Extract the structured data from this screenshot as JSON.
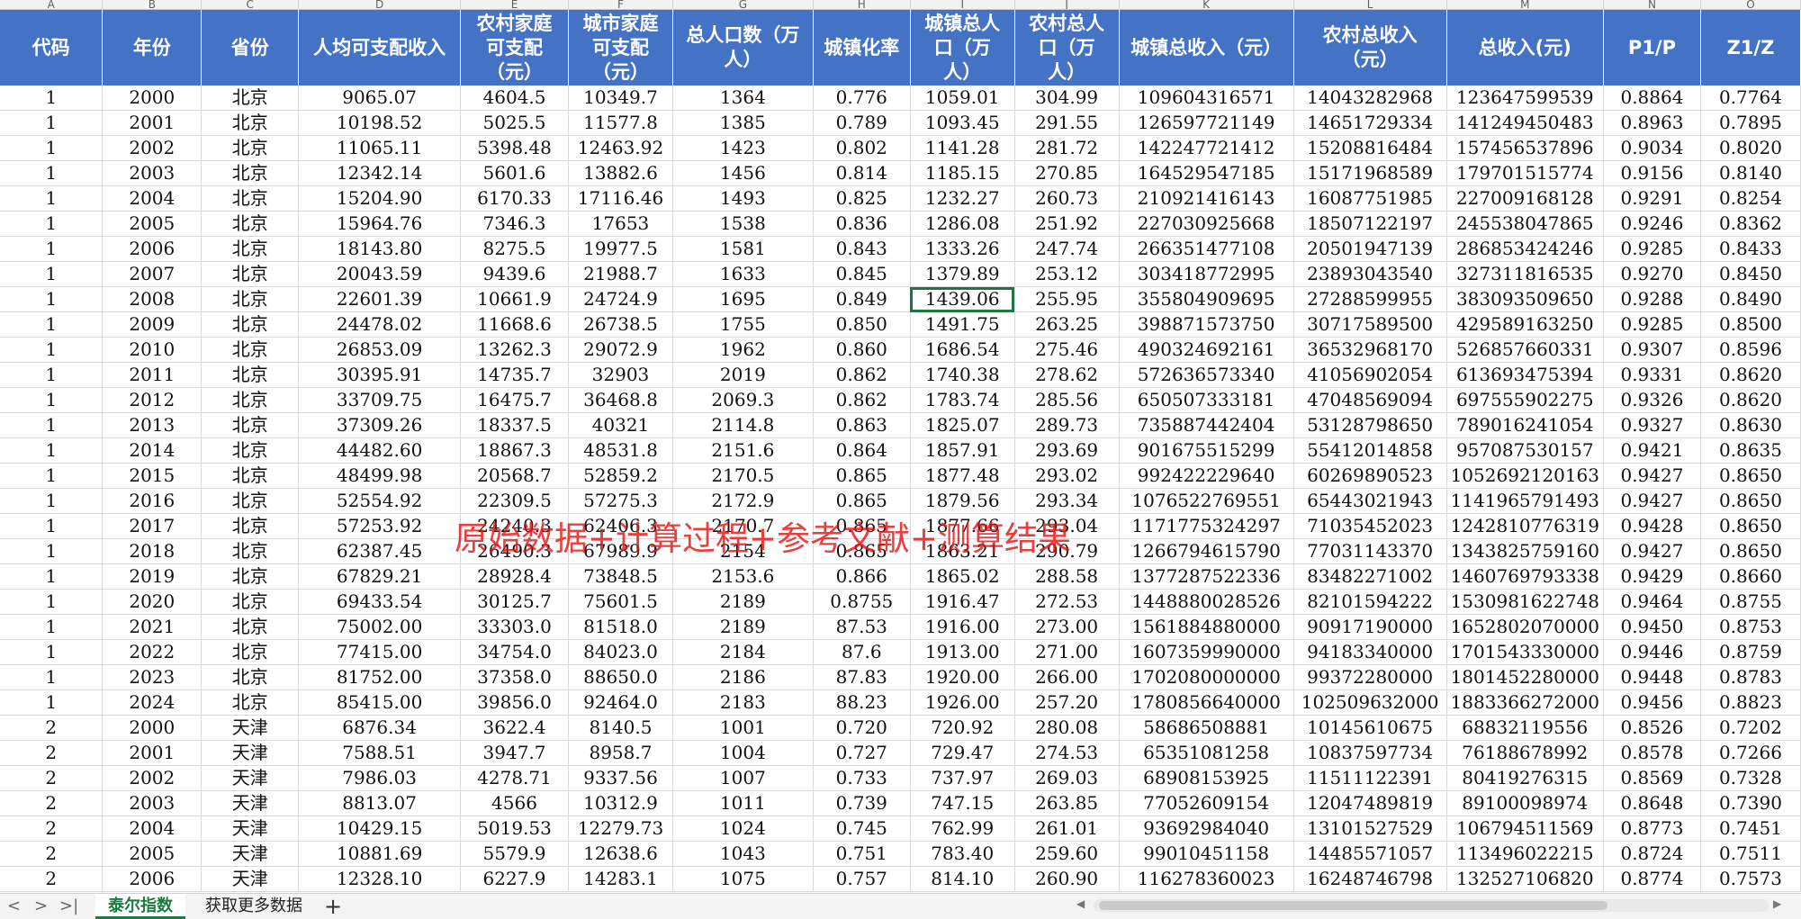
{
  "column_letters": [
    "A",
    "B",
    "C",
    "D",
    "E",
    "F",
    "G",
    "H",
    "I",
    "J",
    "K",
    "L",
    "M",
    "N",
    "O"
  ],
  "headers": [
    [
      "代码"
    ],
    [
      "年份"
    ],
    [
      "省份"
    ],
    [
      "人均可支配收入"
    ],
    [
      "农村家庭",
      "可支配",
      "（元）"
    ],
    [
      "城市家庭",
      "可支配",
      "（元）"
    ],
    [
      "总人口数（万",
      "人）"
    ],
    [
      "城镇化率"
    ],
    [
      "城镇总人",
      "口（万",
      "人）"
    ],
    [
      "农村总人",
      "口（万",
      "人）"
    ],
    [
      "城镇总收入（元）"
    ],
    [
      "农村总收入",
      "（元）"
    ],
    [
      "总收入(元)"
    ],
    [
      "P1/P"
    ],
    [
      "Z1/Z"
    ]
  ],
  "rows": [
    [
      "1",
      "2000",
      "北京",
      "9065.07",
      "4604.5",
      "10349.7",
      "1364",
      "0.776",
      "1059.01",
      "304.99",
      "109604316571",
      "14043282968",
      "123647599539",
      "0.8864",
      "0.7764"
    ],
    [
      "1",
      "2001",
      "北京",
      "10198.52",
      "5025.5",
      "11577.8",
      "1385",
      "0.789",
      "1093.45",
      "291.55",
      "126597721149",
      "14651729334",
      "141249450483",
      "0.8963",
      "0.7895"
    ],
    [
      "1",
      "2002",
      "北京",
      "11065.11",
      "5398.48",
      "12463.92",
      "1423",
      "0.802",
      "1141.28",
      "281.72",
      "142247721412",
      "15208816484",
      "157456537896",
      "0.9034",
      "0.8020"
    ],
    [
      "1",
      "2003",
      "北京",
      "12342.14",
      "5601.6",
      "13882.6",
      "1456",
      "0.814",
      "1185.15",
      "270.85",
      "164529547185",
      "15171968589",
      "179701515774",
      "0.9156",
      "0.8140"
    ],
    [
      "1",
      "2004",
      "北京",
      "15204.90",
      "6170.33",
      "17116.46",
      "1493",
      "0.825",
      "1232.27",
      "260.73",
      "210921416143",
      "16087751985",
      "227009168128",
      "0.9291",
      "0.8254"
    ],
    [
      "1",
      "2005",
      "北京",
      "15964.76",
      "7346.3",
      "17653",
      "1538",
      "0.836",
      "1286.08",
      "251.92",
      "227030925668",
      "18507122197",
      "245538047865",
      "0.9246",
      "0.8362"
    ],
    [
      "1",
      "2006",
      "北京",
      "18143.80",
      "8275.5",
      "19977.5",
      "1581",
      "0.843",
      "1333.26",
      "247.74",
      "266351477108",
      "20501947139",
      "286853424246",
      "0.9285",
      "0.8433"
    ],
    [
      "1",
      "2007",
      "北京",
      "20043.59",
      "9439.6",
      "21988.7",
      "1633",
      "0.845",
      "1379.89",
      "253.12",
      "303418772995",
      "23893043540",
      "327311816535",
      "0.9270",
      "0.8450"
    ],
    [
      "1",
      "2008",
      "北京",
      "22601.39",
      "10661.9",
      "24724.9",
      "1695",
      "0.849",
      "1439.06",
      "255.95",
      "355804909695",
      "27288599955",
      "383093509650",
      "0.9288",
      "0.8490"
    ],
    [
      "1",
      "2009",
      "北京",
      "24478.02",
      "11668.6",
      "26738.5",
      "1755",
      "0.850",
      "1491.75",
      "263.25",
      "398871573750",
      "30717589500",
      "429589163250",
      "0.9285",
      "0.8500"
    ],
    [
      "1",
      "2010",
      "北京",
      "26853.09",
      "13262.3",
      "29072.9",
      "1962",
      "0.860",
      "1686.54",
      "275.46",
      "490324692161",
      "36532968170",
      "526857660331",
      "0.9307",
      "0.8596"
    ],
    [
      "1",
      "2011",
      "北京",
      "30395.91",
      "14735.7",
      "32903",
      "2019",
      "0.862",
      "1740.38",
      "278.62",
      "572636573340",
      "41056902054",
      "613693475394",
      "0.9331",
      "0.8620"
    ],
    [
      "1",
      "2012",
      "北京",
      "33709.75",
      "16475.7",
      "36468.8",
      "2069.3",
      "0.862",
      "1783.74",
      "285.56",
      "650507333181",
      "47048569094",
      "697555902275",
      "0.9326",
      "0.8620"
    ],
    [
      "1",
      "2013",
      "北京",
      "37309.26",
      "18337.5",
      "40321",
      "2114.8",
      "0.863",
      "1825.07",
      "289.73",
      "735887442404",
      "53128798650",
      "789016241054",
      "0.9327",
      "0.8630"
    ],
    [
      "1",
      "2014",
      "北京",
      "44482.60",
      "18867.3",
      "48531.8",
      "2151.6",
      "0.864",
      "1857.91",
      "293.69",
      "901675515299",
      "55412014858",
      "957087530157",
      "0.9421",
      "0.8635"
    ],
    [
      "1",
      "2015",
      "北京",
      "48499.98",
      "20568.7",
      "52859.2",
      "2170.5",
      "0.865",
      "1877.48",
      "293.02",
      "992422229640",
      "60269890523",
      "1052692120163",
      "0.9427",
      "0.8650"
    ],
    [
      "1",
      "2016",
      "北京",
      "52554.92",
      "22309.5",
      "57275.3",
      "2172.9",
      "0.865",
      "1879.56",
      "293.34",
      "1076522769551",
      "65443021943",
      "1141965791493",
      "0.9427",
      "0.8650"
    ],
    [
      "1",
      "2017",
      "北京",
      "57253.92",
      "24240.3",
      "62406.3",
      "2170.7",
      "0.865",
      "1877.66",
      "293.04",
      "1171775324297",
      "71035452023",
      "1242810776319",
      "0.9428",
      "0.8650"
    ],
    [
      "1",
      "2018",
      "北京",
      "62387.45",
      "26490.3",
      "67989.9",
      "2154",
      "0.865",
      "1863.21",
      "290.79",
      "1266794615790",
      "77031143370",
      "1343825759160",
      "0.9427",
      "0.8650"
    ],
    [
      "1",
      "2019",
      "北京",
      "67829.21",
      "28928.4",
      "73848.5",
      "2153.6",
      "0.866",
      "1865.02",
      "288.58",
      "1377287522336",
      "83482271002",
      "1460769793338",
      "0.9429",
      "0.8660"
    ],
    [
      "1",
      "2020",
      "北京",
      "69433.54",
      "30125.7",
      "75601.5",
      "2189",
      "0.8755",
      "1916.47",
      "272.53",
      "1448880028526",
      "82101594222",
      "1530981622748",
      "0.9464",
      "0.8755"
    ],
    [
      "1",
      "2021",
      "北京",
      "75002.00",
      "33303.0",
      "81518.0",
      "2189",
      "87.53",
      "1916.00",
      "273.00",
      "1561884880000",
      "90917190000",
      "1652802070000",
      "0.9450",
      "0.8753"
    ],
    [
      "1",
      "2022",
      "北京",
      "77415.00",
      "34754.0",
      "84023.0",
      "2184",
      "87.6",
      "1913.00",
      "271.00",
      "1607359990000",
      "94183340000",
      "1701543330000",
      "0.9446",
      "0.8759"
    ],
    [
      "1",
      "2023",
      "北京",
      "81752.00",
      "37358.0",
      "88650.0",
      "2186",
      "87.83",
      "1920.00",
      "266.00",
      "1702080000000",
      "99372280000",
      "1801452280000",
      "0.9448",
      "0.8783"
    ],
    [
      "1",
      "2024",
      "北京",
      "85415.00",
      "39856.0",
      "92464.0",
      "2183",
      "88.23",
      "1926.00",
      "257.20",
      "1780856640000",
      "102509632000",
      "1883366272000",
      "0.9456",
      "0.8823"
    ],
    [
      "2",
      "2000",
      "天津",
      "6876.34",
      "3622.4",
      "8140.5",
      "1001",
      "0.720",
      "720.92",
      "280.08",
      "58686508881",
      "10145610675",
      "68832119556",
      "0.8526",
      "0.7202"
    ],
    [
      "2",
      "2001",
      "天津",
      "7588.51",
      "3947.7",
      "8958.7",
      "1004",
      "0.727",
      "729.47",
      "274.53",
      "65351081258",
      "10837597734",
      "76188678992",
      "0.8578",
      "0.7266"
    ],
    [
      "2",
      "2002",
      "天津",
      "7986.03",
      "4278.71",
      "9337.56",
      "1007",
      "0.733",
      "737.97",
      "269.03",
      "68908153925",
      "11511122391",
      "80419276315",
      "0.8569",
      "0.7328"
    ],
    [
      "2",
      "2003",
      "天津",
      "8813.07",
      "4566",
      "10312.9",
      "1011",
      "0.739",
      "747.15",
      "263.85",
      "77052609154",
      "12047489819",
      "89100098974",
      "0.8648",
      "0.7390"
    ],
    [
      "2",
      "2004",
      "天津",
      "10429.15",
      "5019.53",
      "12279.73",
      "1024",
      "0.745",
      "762.99",
      "261.01",
      "93692984040",
      "13101527529",
      "106794511569",
      "0.8773",
      "0.7451"
    ],
    [
      "2",
      "2005",
      "天津",
      "10881.69",
      "5579.9",
      "12638.6",
      "1043",
      "0.751",
      "783.40",
      "259.60",
      "99010451158",
      "14485571057",
      "113496022215",
      "0.8724",
      "0.7511"
    ],
    [
      "2",
      "2006",
      "天津",
      "12328.10",
      "6227.9",
      "14283.1",
      "1075",
      "0.757",
      "814.10",
      "260.90",
      "116278360023",
      "16248746798",
      "132527106820",
      "0.8774",
      "0.7573"
    ]
  ],
  "selected_cell": {
    "row": 8,
    "col": 8
  },
  "watermark": "原始数据+计算过程+参考文献+测算结果",
  "tabs": {
    "nav": [
      "<",
      ">",
      ">|"
    ],
    "sheet1": "泰尔指数",
    "sheet2": "获取更多数据",
    "add": "+"
  },
  "colors": {
    "header_bg": "#4472c4",
    "header_text": "#ffffff",
    "selection": "#217346",
    "watermark": "#e61414",
    "active_tab": "#1a7a40"
  }
}
